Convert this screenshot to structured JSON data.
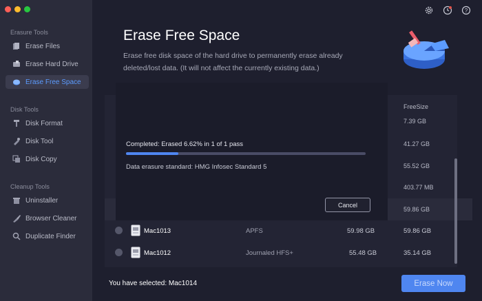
{
  "window": {
    "traffic_colors": [
      "#ff5f57",
      "#febc2e",
      "#28c840"
    ]
  },
  "sidebar": {
    "sections": [
      {
        "title": "Erasure Tools",
        "items": [
          {
            "label": "Erase Files",
            "icon": "files-icon"
          },
          {
            "label": "Erase Hard Drive",
            "icon": "hard-drive-icon"
          },
          {
            "label": "Erase Free Space",
            "icon": "free-space-icon",
            "active": true
          }
        ]
      },
      {
        "title": "Disk Tools",
        "items": [
          {
            "label": "Disk Format",
            "icon": "format-icon"
          },
          {
            "label": "Disk Tool",
            "icon": "tool-icon"
          },
          {
            "label": "Disk Copy",
            "icon": "copy-icon"
          }
        ]
      },
      {
        "title": "Cleanup Tools",
        "items": [
          {
            "label": "Uninstaller",
            "icon": "uninstaller-icon"
          },
          {
            "label": "Browser Cleaner",
            "icon": "browser-cleaner-icon"
          },
          {
            "label": "Duplicate Finder",
            "icon": "duplicate-finder-icon"
          }
        ]
      }
    ]
  },
  "header": {
    "title": "Erase Free Space",
    "description": "Erase free disk space of the hard drive to permanently erase already deleted/lost data. (It will not affect the currently existing data.)"
  },
  "table": {
    "freesize_header": "FreeSize",
    "freesize_values": [
      "7.39 GB",
      "41.27 GB",
      "55.52 GB",
      "403.77 MB",
      "59.86 GB"
    ],
    "rows": [
      {
        "name": "Mac1013",
        "format": "APFS",
        "capacity": "59.98 GB",
        "free": "59.86 GB"
      },
      {
        "name": "Mac1012",
        "format": "Journaled HFS+",
        "capacity": "55.48 GB",
        "free": "35.14 GB"
      }
    ]
  },
  "dialog": {
    "progress_text": "Completed: Erased 6.62% in 1 of 1 pass",
    "progress_fraction": 0.0662,
    "standard_text": "Data erasure standard: HMG Infosec Standard 5",
    "cancel_label": "Cancel"
  },
  "footer": {
    "selected_text": "You have selected: Mac1014",
    "erase_label": "Erase Now"
  },
  "colors": {
    "accent": "#4f86f0",
    "sidebar_active_text": "#5c9cff"
  }
}
